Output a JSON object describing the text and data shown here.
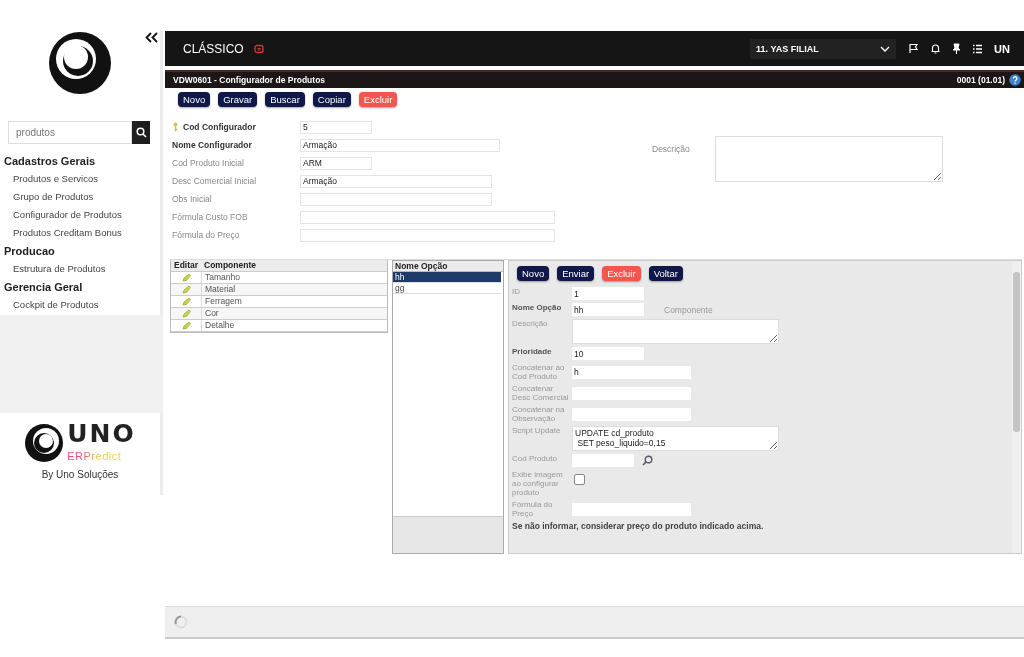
{
  "sidebar": {
    "search": {
      "placeholder": "produtos"
    },
    "groups": [
      {
        "title": "Cadastros Gerais",
        "items": [
          {
            "label": "Produtos e Servicos"
          },
          {
            "label": "Grupo de Produtos"
          },
          {
            "label": "Configurador de Produtos"
          },
          {
            "label": "Produtos Creditam Bonus"
          }
        ]
      },
      {
        "title": "Producao",
        "items": [
          {
            "label": "Estrutura de Produtos"
          }
        ]
      },
      {
        "title": "Gerencia Geral",
        "items": [
          {
            "label": "Cockpit de Produtos"
          }
        ]
      }
    ],
    "brand": {
      "name": "UNO",
      "tagline": "ERPredict",
      "credit": "By Uno Soluções"
    }
  },
  "topbar": {
    "mode": "CLÁSSICO",
    "branch": "11. YAS FILIAL",
    "user": "UN"
  },
  "window": {
    "title": "VDW0601 - Configurador de Produtos",
    "version": "0001 (01.01)"
  },
  "toolbar": [
    {
      "label": "Novo",
      "kind": "primary"
    },
    {
      "label": "Gravar",
      "kind": "primary"
    },
    {
      "label": "Buscar",
      "kind": "primary"
    },
    {
      "label": "Copiar",
      "kind": "primary"
    },
    {
      "label": "Excluir",
      "kind": "danger"
    }
  ],
  "form": {
    "fields": [
      {
        "label": "Cod Configurador",
        "value": "5",
        "kind": "short",
        "required": true,
        "key": true
      },
      {
        "label": "Nome Configurador",
        "value": "Armação",
        "kind": "wide",
        "required": true,
        "key": false
      },
      {
        "label": "Cod Produto Inicial",
        "value": "ARM",
        "kind": "short",
        "required": false,
        "key": false
      },
      {
        "label": "Desc Comercial Inicial",
        "value": "Armação",
        "kind": "medium",
        "required": false,
        "key": false
      },
      {
        "label": "Obs Inicial",
        "kind": "medium",
        "required": false,
        "key": false
      },
      {
        "label": "Fórmula Custo FOB",
        "kind": "long",
        "required": false,
        "key": false
      },
      {
        "label": "Fórmula do Preço",
        "kind": "long",
        "required": false,
        "key": false
      }
    ],
    "description": {
      "label": "Descrição"
    }
  },
  "components": {
    "columns": [
      "Editar",
      "Componente"
    ],
    "rows": [
      {
        "name": "Tamanho"
      },
      {
        "name": "Material"
      },
      {
        "name": "Ferragem"
      },
      {
        "name": "Cor"
      },
      {
        "name": "Detalhe"
      }
    ]
  },
  "options": {
    "column": "Nome Opção",
    "rows": [
      {
        "name": "hh",
        "selected": true
      },
      {
        "name": "gg",
        "selected": false
      }
    ]
  },
  "option_toolbar": [
    {
      "label": "Novo",
      "kind": "primary"
    },
    {
      "label": "Enviar",
      "kind": "primary"
    },
    {
      "label": "Excluir",
      "kind": "danger"
    },
    {
      "label": "Voltar",
      "kind": "primary"
    }
  ],
  "option_form": {
    "fields": [
      {
        "label": "ID",
        "value": "1",
        "kind": "short",
        "required": false
      },
      {
        "label": "Nome Opção",
        "value": "hh",
        "kind": "short",
        "required": true,
        "aside": "Componente"
      },
      {
        "label": "Descrição",
        "kind": "area",
        "required": false
      },
      {
        "label": "Prioridade",
        "value": "10",
        "kind": "short",
        "required": true
      },
      {
        "label": "Concatenar ao Cod Produto",
        "value": "h",
        "kind": "medium",
        "required": false
      },
      {
        "label": "Concatenar Desc Comercial",
        "kind": "medium",
        "required": false
      },
      {
        "label": "Concatenar na Observação",
        "kind": "medium",
        "required": false
      },
      {
        "label": "Script Update",
        "value": "UPDATE cd_produto\n SET peso_liquido=0,15",
        "kind": "area",
        "required": false
      },
      {
        "label": "Cod Produto",
        "kind": "lookup",
        "required": false
      },
      {
        "label": "Exibe imagem ao configurar produto",
        "kind": "check",
        "checked": false,
        "required": false
      },
      {
        "label": "Fórmula do Preço",
        "kind": "medium",
        "required": false
      }
    ],
    "note": "Se não informar, considerar preço do produto indicado acima."
  }
}
